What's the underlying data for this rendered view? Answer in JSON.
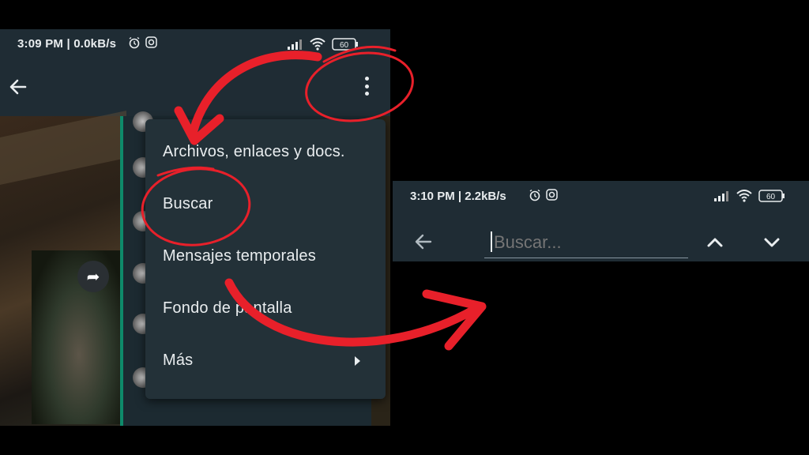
{
  "left_screen": {
    "status_time": "3:09 PM | 0.0kB/s",
    "status_icons": [
      "alarm-icon",
      "instagram-icon"
    ],
    "battery": "60",
    "menu_items": [
      {
        "label": "Archivos, enlaces y docs."
      },
      {
        "label": "Buscar"
      },
      {
        "label": "Mensajes temporales"
      },
      {
        "label": "Fondo de pantalla"
      },
      {
        "label": "Más"
      }
    ]
  },
  "right_screen": {
    "status_time": "3:10 PM | 2.2kB/s",
    "status_icons": [
      "alarm-icon",
      "instagram-icon"
    ],
    "battery": "60",
    "search_placeholder": "Buscar..."
  },
  "colors": {
    "annotation_red": "#e8202a",
    "toolbar": "#1f2c34",
    "menu_bg": "#233138",
    "text": "#e9edef",
    "accent_green": "#0e8a6a"
  }
}
